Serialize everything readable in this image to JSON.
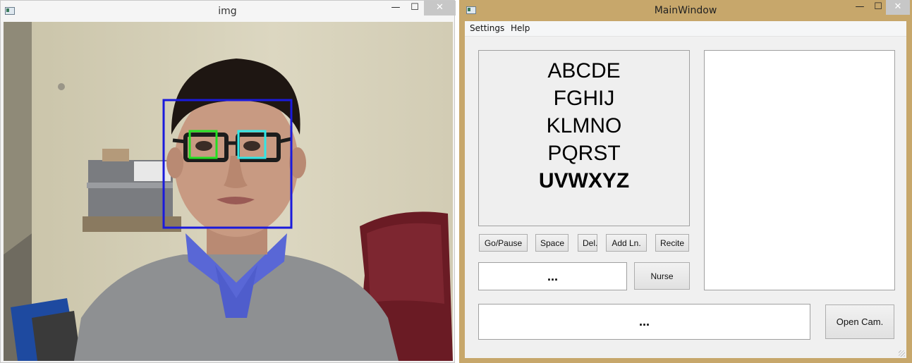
{
  "img_window": {
    "title": "img",
    "controls": {
      "minimize": "—",
      "maximize": "☐",
      "close": "✕"
    }
  },
  "main_window": {
    "title": "MainWindow",
    "controls": {
      "minimize": "—",
      "maximize": "☐",
      "close": "✕"
    },
    "menu": [
      "Settings",
      "Help"
    ],
    "letter_rows": [
      "ABCDE",
      "FGHIJ",
      "KLMNO",
      "PQRST",
      "UVWXYZ"
    ],
    "active_row": "UVWXYZ",
    "buttons": {
      "go_pause": "Go/Pause",
      "space": "Space",
      "delete": "Del.",
      "add_line": "Add Ln.",
      "recite": "Recite",
      "nurse": "Nurse",
      "open_cam": "Open Cam."
    },
    "current_word": "...",
    "sentence": "..."
  },
  "colors": {
    "face_box": "#1a1adc",
    "left_eye_box": "#22e022",
    "right_eye_box": "#30e6e6",
    "main_frame": "#c7a76b",
    "close_button": "#c7c7c7"
  }
}
